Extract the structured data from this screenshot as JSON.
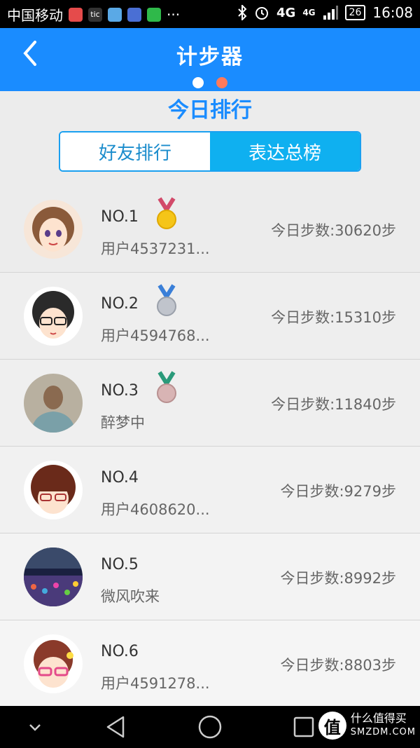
{
  "status_bar": {
    "carrier": "中国移动",
    "app_icons": [
      "calendar-app-icon",
      "tic-app-icon",
      "clock-app-icon",
      "health-app-icon",
      "wechat-app-icon"
    ],
    "tic_text": "tic",
    "more": "···",
    "network_1": "4G",
    "network_2": "4G",
    "battery": "26",
    "time": "16:08"
  },
  "app_bar": {
    "title": "计步器",
    "page_dots": [
      {
        "state": "active",
        "color": "#ffffff"
      },
      {
        "state": "inactive",
        "color": "#ff7a5a"
      }
    ]
  },
  "section_title": "今日排行",
  "tabs": [
    {
      "label": "好友排行",
      "active": false
    },
    {
      "label": "表达总榜",
      "active": true
    }
  ],
  "rankings": [
    {
      "rank": "NO.1",
      "name": "用户4537231...",
      "steps": "今日步数:30620步",
      "medal": "gold",
      "avatar": "cartoon-girl-curly-hair"
    },
    {
      "rank": "NO.2",
      "name": "用户4594768...",
      "steps": "今日步数:15310步",
      "medal": "silver",
      "avatar": "cartoon-girl-glasses"
    },
    {
      "rank": "NO.3",
      "name": "醉梦中",
      "steps": "今日步数:11840步",
      "medal": "bronze",
      "avatar": "photo-man"
    },
    {
      "rank": "NO.4",
      "name": "用户4608620...",
      "steps": "今日步数:9279步",
      "medal": null,
      "avatar": "cartoon-girl-bangs"
    },
    {
      "rank": "NO.5",
      "name": "微风吹来",
      "steps": "今日步数:8992步",
      "medal": null,
      "avatar": "photo-crowd"
    },
    {
      "rank": "NO.6",
      "name": "用户4591278...",
      "steps": "今日步数:8803步",
      "medal": null,
      "avatar": "cartoon-girl-pink-glasses"
    }
  ],
  "colors": {
    "app_bar": "#1a8cff",
    "accent": "#1a8cff",
    "tab_active": "#0fb0f0",
    "gold": "#f5c518",
    "silver": "#c0c4cc",
    "bronze": "#d8b4b4"
  },
  "nav_bar": {
    "buttons": [
      "chevron-down-icon",
      "back-triangle-icon",
      "home-circle-icon",
      "recents-square-icon"
    ]
  },
  "watermark": {
    "icon_text": "值",
    "line1": "什么值得买",
    "line2": "SMZDM.COM"
  }
}
